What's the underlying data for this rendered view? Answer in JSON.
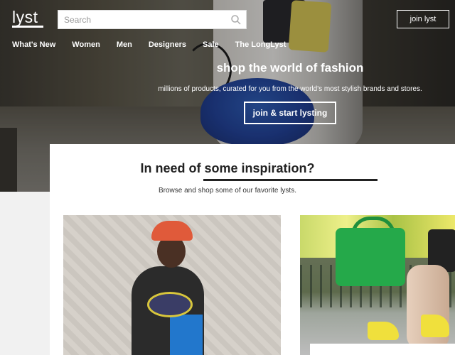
{
  "header": {
    "logo": "lyst",
    "search_placeholder": "Search",
    "join_label": "join lyst"
  },
  "nav": {
    "items": [
      "What's New",
      "Women",
      "Men",
      "Designers",
      "Sale",
      "The LongLyst"
    ]
  },
  "hero": {
    "title": "shop the world of fashion",
    "subtitle": "millions of products, curated for you from the world's most stylish brands and stores.",
    "cta_label": "join & start lysting"
  },
  "inspiration": {
    "title": "In need of some inspiration?",
    "subtitle": "Browse and shop some of our favorite lysts."
  },
  "colors": {
    "hero_text": "#ffffff",
    "panel_bg": "#ffffff",
    "page_bg": "#f1f1f1",
    "heading": "#222222"
  }
}
